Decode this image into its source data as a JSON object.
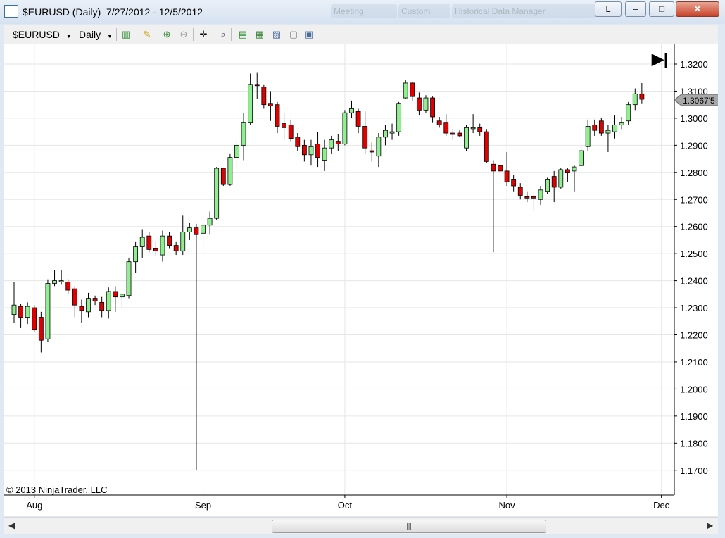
{
  "window": {
    "title": "$EURUSD (Daily)  7/27/2012 - 12/5/2012",
    "bg_tabs": [
      "Meeting",
      "Custom",
      "Historical Data Manager"
    ],
    "btn_l": "L",
    "btn_min": "–",
    "btn_max": "□",
    "btn_close": "✕"
  },
  "toolbar": {
    "instrument": "$EURUSD",
    "interval": "Daily"
  },
  "chart": {
    "copyright": "© 2013 NinjaTrader, LLC",
    "price_marker": "1.3067'5",
    "go_end": "▶|"
  },
  "scroll": {
    "grip": "|||"
  },
  "colors": {
    "up": "#90ee90",
    "down": "#e00000",
    "wick": "#000000",
    "grid": "#e6e6e6"
  },
  "chart_data": {
    "type": "candlestick",
    "ylim": [
      1.165,
      1.325
    ],
    "yticks": [
      "1.3200",
      "1.3100",
      "1.3000",
      "1.2900",
      "1.2800",
      "1.2700",
      "1.2600",
      "1.2500",
      "1.2400",
      "1.2300",
      "1.2200",
      "1.2100",
      "1.2000",
      "1.1900",
      "1.1800",
      "1.1700"
    ],
    "xticks": [
      "Aug",
      "Sep",
      "Oct",
      "Nov",
      "Dec"
    ],
    "current_price": 1.30675,
    "candles": [
      {
        "o": 1.2275,
        "h": 1.2395,
        "l": 1.2245,
        "c": 1.231
      },
      {
        "o": 1.2305,
        "h": 1.2315,
        "l": 1.2225,
        "c": 1.2265
      },
      {
        "o": 1.2265,
        "h": 1.232,
        "l": 1.224,
        "c": 1.2305
      },
      {
        "o": 1.23,
        "h": 1.231,
        "l": 1.221,
        "c": 1.222
      },
      {
        "o": 1.2265,
        "h": 1.2285,
        "l": 1.2135,
        "c": 1.218
      },
      {
        "o": 1.2185,
        "h": 1.2405,
        "l": 1.2175,
        "c": 1.239
      },
      {
        "o": 1.239,
        "h": 1.244,
        "l": 1.238,
        "c": 1.24
      },
      {
        "o": 1.24,
        "h": 1.244,
        "l": 1.2385,
        "c": 1.24
      },
      {
        "o": 1.2395,
        "h": 1.2405,
        "l": 1.235,
        "c": 1.2365
      },
      {
        "o": 1.237,
        "h": 1.238,
        "l": 1.2265,
        "c": 1.231
      },
      {
        "o": 1.2305,
        "h": 1.233,
        "l": 1.2245,
        "c": 1.229
      },
      {
        "o": 1.2285,
        "h": 1.2355,
        "l": 1.2265,
        "c": 1.2335
      },
      {
        "o": 1.2335,
        "h": 1.2345,
        "l": 1.231,
        "c": 1.2325
      },
      {
        "o": 1.232,
        "h": 1.234,
        "l": 1.2265,
        "c": 1.229
      },
      {
        "o": 1.229,
        "h": 1.2375,
        "l": 1.226,
        "c": 1.236
      },
      {
        "o": 1.236,
        "h": 1.238,
        "l": 1.2285,
        "c": 1.234
      },
      {
        "o": 1.234,
        "h": 1.2355,
        "l": 1.23,
        "c": 1.235
      },
      {
        "o": 1.2345,
        "h": 1.2485,
        "l": 1.2335,
        "c": 1.247
      },
      {
        "o": 1.247,
        "h": 1.2545,
        "l": 1.243,
        "c": 1.2525
      },
      {
        "o": 1.2525,
        "h": 1.259,
        "l": 1.2485,
        "c": 1.256
      },
      {
        "o": 1.2565,
        "h": 1.258,
        "l": 1.2505,
        "c": 1.2515
      },
      {
        "o": 1.252,
        "h": 1.2545,
        "l": 1.249,
        "c": 1.251
      },
      {
        "o": 1.2495,
        "h": 1.2585,
        "l": 1.247,
        "c": 1.2565
      },
      {
        "o": 1.2565,
        "h": 1.258,
        "l": 1.252,
        "c": 1.253
      },
      {
        "o": 1.253,
        "h": 1.2545,
        "l": 1.2495,
        "c": 1.251
      },
      {
        "o": 1.251,
        "h": 1.264,
        "l": 1.2495,
        "c": 1.258
      },
      {
        "o": 1.258,
        "h": 1.2615,
        "l": 1.255,
        "c": 1.2595
      },
      {
        "o": 1.2595,
        "h": 1.261,
        "l": 1.17,
        "c": 1.257
      },
      {
        "o": 1.2575,
        "h": 1.263,
        "l": 1.2505,
        "c": 1.2605
      },
      {
        "o": 1.2605,
        "h": 1.2655,
        "l": 1.257,
        "c": 1.263
      },
      {
        "o": 1.263,
        "h": 1.282,
        "l": 1.2625,
        "c": 1.2815
      },
      {
        "o": 1.2815,
        "h": 1.281,
        "l": 1.275,
        "c": 1.2755
      },
      {
        "o": 1.2755,
        "h": 1.287,
        "l": 1.275,
        "c": 1.2855
      },
      {
        "o": 1.2855,
        "h": 1.2925,
        "l": 1.282,
        "c": 1.29
      },
      {
        "o": 1.29,
        "h": 1.302,
        "l": 1.2845,
        "c": 1.2985
      },
      {
        "o": 1.2985,
        "h": 1.3165,
        "l": 1.2975,
        "c": 1.3125
      },
      {
        "o": 1.3125,
        "h": 1.317,
        "l": 1.307,
        "c": 1.312
      },
      {
        "o": 1.3115,
        "h": 1.3125,
        "l": 1.3035,
        "c": 1.305
      },
      {
        "o": 1.3055,
        "h": 1.31,
        "l": 1.299,
        "c": 1.3045
      },
      {
        "o": 1.305,
        "h": 1.306,
        "l": 1.2945,
        "c": 1.297
      },
      {
        "o": 1.298,
        "h": 1.302,
        "l": 1.292,
        "c": 1.2965
      },
      {
        "o": 1.2975,
        "h": 1.2995,
        "l": 1.2915,
        "c": 1.2925
      },
      {
        "o": 1.293,
        "h": 1.2945,
        "l": 1.288,
        "c": 1.2895
      },
      {
        "o": 1.29,
        "h": 1.292,
        "l": 1.284,
        "c": 1.2865
      },
      {
        "o": 1.2865,
        "h": 1.292,
        "l": 1.2825,
        "c": 1.2895
      },
      {
        "o": 1.2905,
        "h": 1.295,
        "l": 1.282,
        "c": 1.2855
      },
      {
        "o": 1.2845,
        "h": 1.292,
        "l": 1.2805,
        "c": 1.289
      },
      {
        "o": 1.289,
        "h": 1.2935,
        "l": 1.287,
        "c": 1.292
      },
      {
        "o": 1.2915,
        "h": 1.294,
        "l": 1.288,
        "c": 1.2905
      },
      {
        "o": 1.2905,
        "h": 1.303,
        "l": 1.29,
        "c": 1.302
      },
      {
        "o": 1.302,
        "h": 1.3065,
        "l": 1.3,
        "c": 1.3035
      },
      {
        "o": 1.3025,
        "h": 1.3035,
        "l": 1.2945,
        "c": 1.297
      },
      {
        "o": 1.297,
        "h": 1.3025,
        "l": 1.287,
        "c": 1.289
      },
      {
        "o": 1.288,
        "h": 1.291,
        "l": 1.284,
        "c": 1.2875
      },
      {
        "o": 1.286,
        "h": 1.2945,
        "l": 1.282,
        "c": 1.293
      },
      {
        "o": 1.293,
        "h": 1.2975,
        "l": 1.29,
        "c": 1.2955
      },
      {
        "o": 1.2945,
        "h": 1.298,
        "l": 1.292,
        "c": 1.295
      },
      {
        "o": 1.295,
        "h": 1.306,
        "l": 1.2935,
        "c": 1.3055
      },
      {
        "o": 1.3075,
        "h": 1.314,
        "l": 1.307,
        "c": 1.313
      },
      {
        "o": 1.313,
        "h": 1.3135,
        "l": 1.3065,
        "c": 1.308
      },
      {
        "o": 1.3075,
        "h": 1.3095,
        "l": 1.301,
        "c": 1.303
      },
      {
        "o": 1.303,
        "h": 1.3085,
        "l": 1.302,
        "c": 1.3075
      },
      {
        "o": 1.3075,
        "h": 1.308,
        "l": 1.2985,
        "c": 1.3005
      },
      {
        "o": 1.299,
        "h": 1.3005,
        "l": 1.2965,
        "c": 1.2975
      },
      {
        "o": 1.2985,
        "h": 1.3015,
        "l": 1.2935,
        "c": 1.2945
      },
      {
        "o": 1.2945,
        "h": 1.296,
        "l": 1.292,
        "c": 1.294
      },
      {
        "o": 1.2945,
        "h": 1.2955,
        "l": 1.293,
        "c": 1.2935
      },
      {
        "o": 1.289,
        "h": 1.2975,
        "l": 1.288,
        "c": 1.2965
      },
      {
        "o": 1.2965,
        "h": 1.3015,
        "l": 1.2945,
        "c": 1.2965
      },
      {
        "o": 1.2965,
        "h": 1.298,
        "l": 1.2935,
        "c": 1.295
      },
      {
        "o": 1.295,
        "h": 1.296,
        "l": 1.2835,
        "c": 1.284
      },
      {
        "o": 1.283,
        "h": 1.2845,
        "l": 1.2505,
        "c": 1.2805
      },
      {
        "o": 1.2825,
        "h": 1.2835,
        "l": 1.278,
        "c": 1.2805
      },
      {
        "o": 1.2805,
        "h": 1.2875,
        "l": 1.275,
        "c": 1.2765
      },
      {
        "o": 1.2775,
        "h": 1.279,
        "l": 1.273,
        "c": 1.275
      },
      {
        "o": 1.2745,
        "h": 1.276,
        "l": 1.27,
        "c": 1.2715
      },
      {
        "o": 1.271,
        "h": 1.273,
        "l": 1.269,
        "c": 1.2705
      },
      {
        "o": 1.271,
        "h": 1.272,
        "l": 1.266,
        "c": 1.2705
      },
      {
        "o": 1.27,
        "h": 1.275,
        "l": 1.268,
        "c": 1.2735
      },
      {
        "o": 1.273,
        "h": 1.278,
        "l": 1.272,
        "c": 1.2775
      },
      {
        "o": 1.2785,
        "h": 1.2805,
        "l": 1.269,
        "c": 1.2745
      },
      {
        "o": 1.2745,
        "h": 1.2815,
        "l": 1.274,
        "c": 1.281
      },
      {
        "o": 1.281,
        "h": 1.2815,
        "l": 1.2765,
        "c": 1.28
      },
      {
        "o": 1.2805,
        "h": 1.2825,
        "l": 1.273,
        "c": 1.282
      },
      {
        "o": 1.2825,
        "h": 1.289,
        "l": 1.282,
        "c": 1.288
      },
      {
        "o": 1.2895,
        "h": 1.2995,
        "l": 1.288,
        "c": 1.297
      },
      {
        "o": 1.2975,
        "h": 1.2995,
        "l": 1.2935,
        "c": 1.2955
      },
      {
        "o": 1.299,
        "h": 1.3,
        "l": 1.2935,
        "c": 1.2945
      },
      {
        "o": 1.2945,
        "h": 1.2975,
        "l": 1.2875,
        "c": 1.2955
      },
      {
        "o": 1.295,
        "h": 1.301,
        "l": 1.2925,
        "c": 1.2975
      },
      {
        "o": 1.2975,
        "h": 1.3005,
        "l": 1.296,
        "c": 1.2985
      },
      {
        "o": 1.299,
        "h": 1.306,
        "l": 1.2975,
        "c": 1.305
      },
      {
        "o": 1.305,
        "h": 1.311,
        "l": 1.303,
        "c": 1.309
      },
      {
        "o": 1.309,
        "h": 1.313,
        "l": 1.3055,
        "c": 1.307
      }
    ]
  }
}
